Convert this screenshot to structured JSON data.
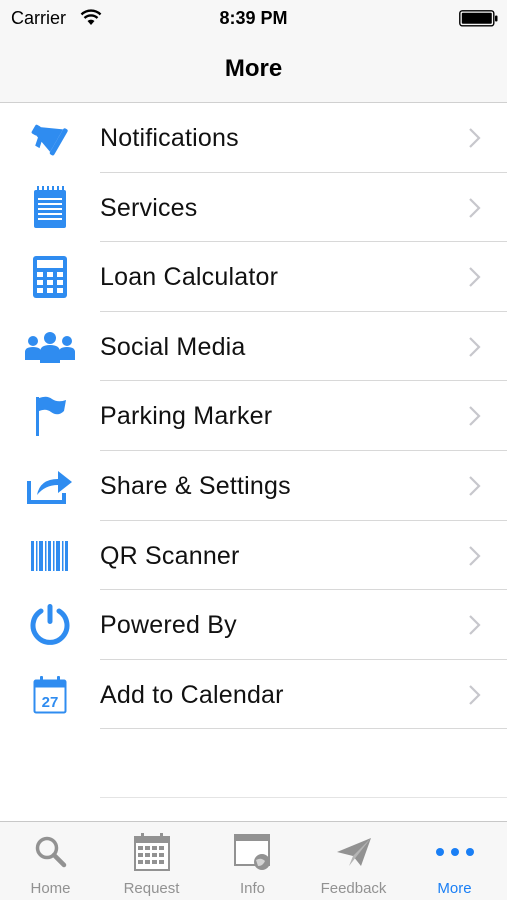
{
  "status_bar": {
    "carrier": "Carrier",
    "time": "8:39 PM"
  },
  "nav": {
    "title": "More"
  },
  "menu": {
    "items": [
      {
        "label": "Notifications",
        "icon": "megaphone-icon"
      },
      {
        "label": "Services",
        "icon": "notepad-icon"
      },
      {
        "label": "Loan Calculator",
        "icon": "calculator-icon"
      },
      {
        "label": "Social Media",
        "icon": "people-icon"
      },
      {
        "label": "Parking Marker",
        "icon": "flag-icon"
      },
      {
        "label": "Share & Settings",
        "icon": "share-icon"
      },
      {
        "label": "QR Scanner",
        "icon": "barcode-icon"
      },
      {
        "label": "Powered By",
        "icon": "power-icon"
      },
      {
        "label": "Add to Calendar",
        "icon": "calendar-icon"
      }
    ],
    "calendar_day": "27"
  },
  "tabs": [
    {
      "label": "Home",
      "icon": "search-icon",
      "active": false
    },
    {
      "label": "Request",
      "icon": "calendar-grid-icon",
      "active": false
    },
    {
      "label": "Info",
      "icon": "browser-globe-icon",
      "active": false
    },
    {
      "label": "Feedback",
      "icon": "paper-plane-icon",
      "active": false
    },
    {
      "label": "More",
      "icon": "more-dots-icon",
      "active": true
    }
  ],
  "colors": {
    "accent": "#1a7ff5",
    "icon_blue": "#2f8cf0",
    "tab_inactive": "#929292"
  }
}
